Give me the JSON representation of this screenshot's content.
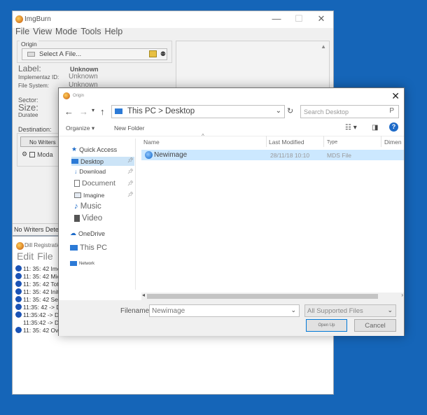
{
  "main_window": {
    "title": "ImgBurn",
    "menu": [
      "File",
      "View",
      "Mode",
      "Tools",
      "Help"
    ],
    "origin_legend": "Origin",
    "source_placeholder": "Select A File...",
    "label_caption": "Label:",
    "label_value": "Unknown",
    "impl_caption": "Implementaz ID:",
    "impl_value": "Unknown",
    "filesystem_caption": "File System:",
    "filesystem_value": "Unknown",
    "sector_caption": "Sector:",
    "size_caption": "Size:",
    "duration_caption": "Duratee",
    "destination_caption": "Destination:",
    "no_writers_btn": "No Writers",
    "mode_checkbox": "Moda",
    "status_text": "No Writers Detect"
  },
  "log_window": {
    "title": "Dill Registration",
    "menu": [
      "Edit",
      "File"
    ],
    "lines": [
      "11: 35: 42 Imot",
      "11: 35: 42 Micr",
      "11: 35: 42 Tota",
      "11: 35: 42 Initia",
      "11: 35: 42 Sear",
      "11:35: 42 -> D",
      "11:35:42 -> D",
      "11:35:42 -> D",
      "11: 35: 42 Over"
    ]
  },
  "dialog": {
    "title": "Origin",
    "address": "This PC > Desktop",
    "search_placeholder": "Search Desktop",
    "toolbar": {
      "organize": "Organize",
      "new_folder": "New Folder"
    },
    "nav": {
      "quick_access": "Quick Access",
      "desktop": "Desktop",
      "downloads": "Download",
      "documents": "Document",
      "images": "Imagine",
      "music": "Music",
      "video": "Video",
      "onedrive": "OneDrive",
      "this_pc": "This PC",
      "network": "Network"
    },
    "columns": [
      "Name",
      "Last Modified",
      "Type",
      "Dimen"
    ],
    "files": [
      {
        "name": "Newimage",
        "modified": "28/11/18 10:10",
        "type": "MDS File"
      }
    ],
    "filename_label": "Filename:",
    "filename_value": "Newimage",
    "filetype_value": "All Supported Files",
    "open_label": "Open Up",
    "cancel_label": "Cancel"
  }
}
